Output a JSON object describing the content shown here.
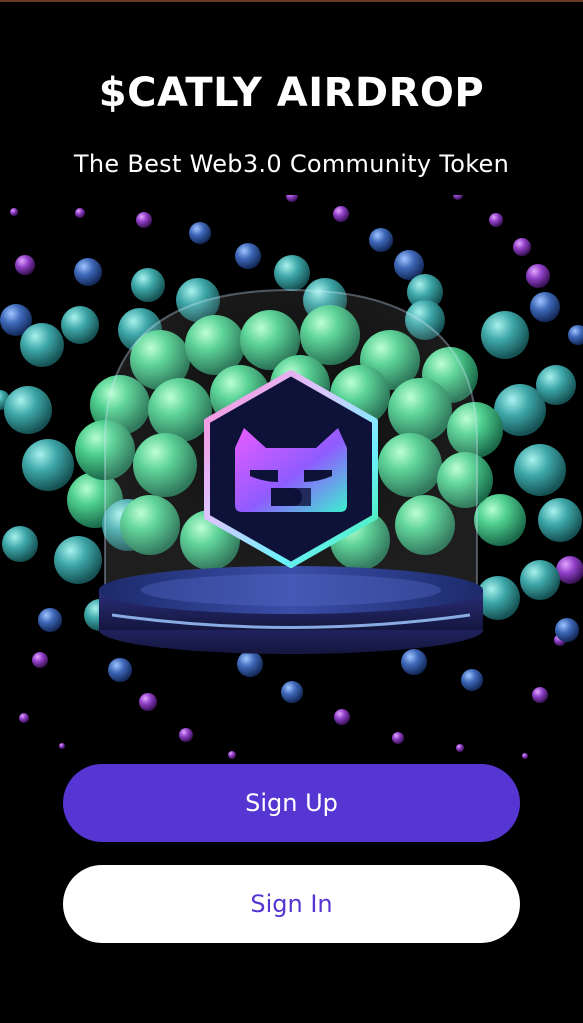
{
  "header": {
    "title": "$CATLY AIRDROP",
    "subtitle": "The Best Web3.0 Community Token"
  },
  "hero": {
    "icon": "cat-logo-icon"
  },
  "actions": {
    "signup_label": "Sign Up",
    "signin_label": "Sign In"
  },
  "colors": {
    "background": "#000000",
    "primary": "#5636d3",
    "button_light": "#ffffff"
  }
}
